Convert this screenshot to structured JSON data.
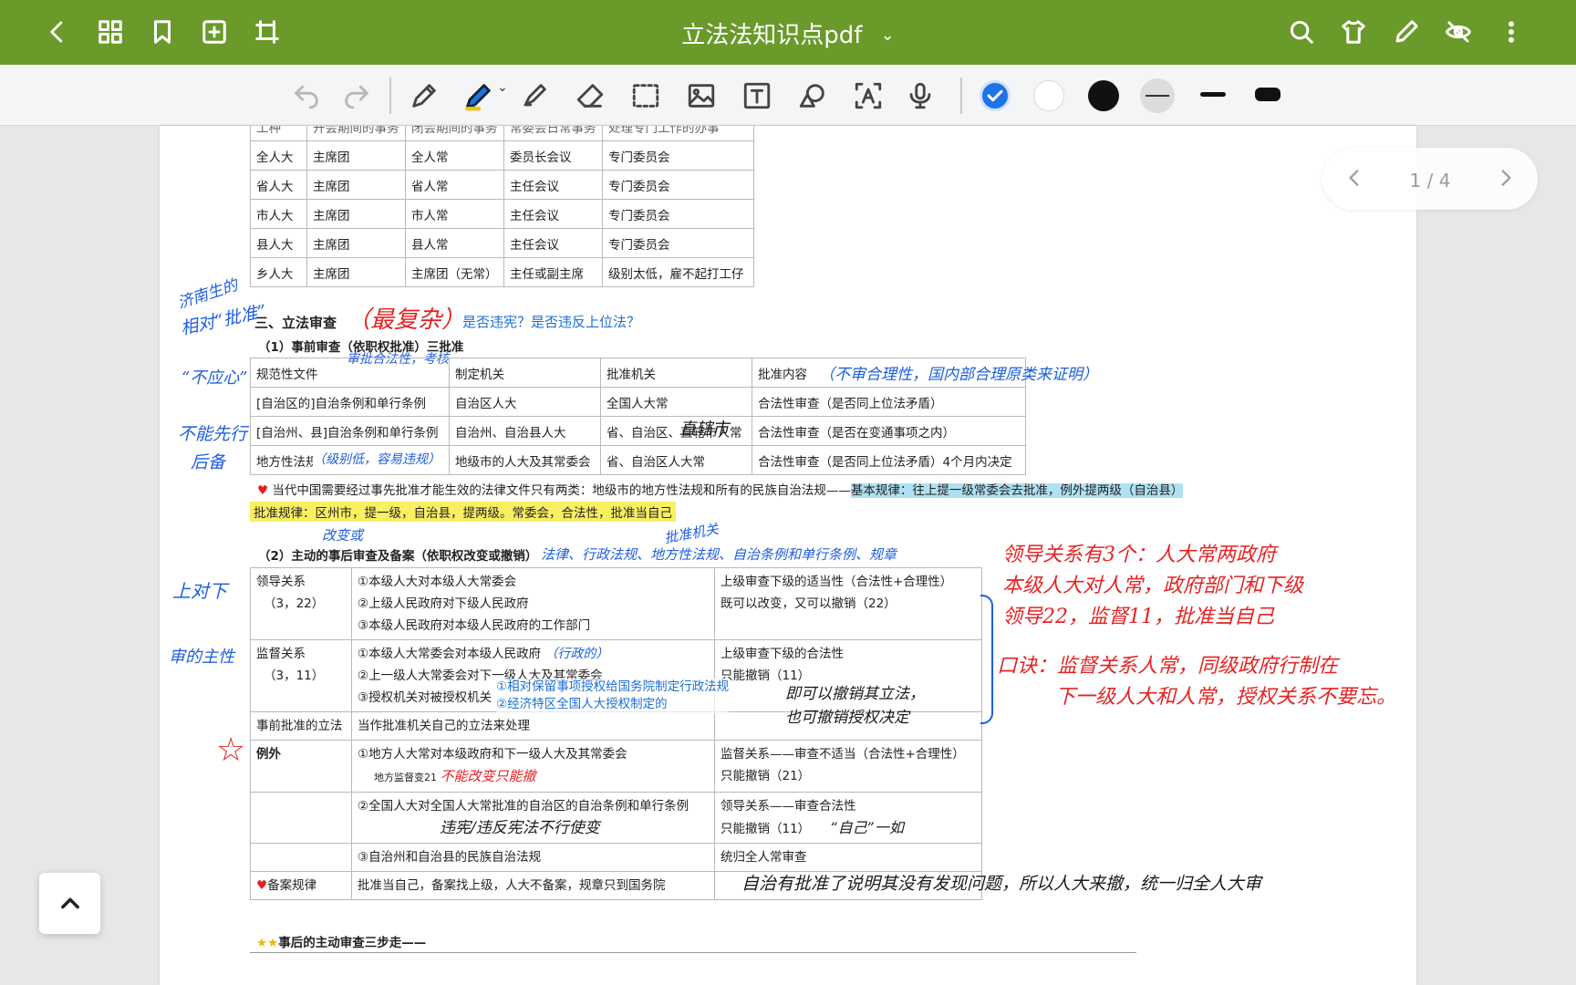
{
  "app": {
    "title": "立法法知识点pdf",
    "bar_color": "#6a9a2a"
  },
  "toolbar": {
    "icons": [
      "undo-icon",
      "redo-icon",
      "fountain-pen-icon",
      "highlighter-pen-icon",
      "marker-icon",
      "eraser-icon",
      "lasso-select-icon",
      "image-icon",
      "text-box-icon",
      "shape-icon",
      "text-recognition-icon",
      "microphone-icon"
    ],
    "colors": {
      "selected": "#1f73e8",
      "white": "#ffffff",
      "black": "#111111",
      "gray": "#dcdcdc"
    }
  },
  "pager": {
    "label": "1 / 4"
  },
  "table1": {
    "header": [
      "工种",
      "开会期间的事务",
      "闭会期间的事务",
      "常委会日常事务",
      "处理专门工作的办事"
    ],
    "rows": [
      [
        "全人大",
        "主席团",
        "全人常",
        "委员长会议",
        "专门委员会"
      ],
      [
        "省人大",
        "主席团",
        "省人常",
        "主任会议",
        "专门委员会"
      ],
      [
        "市人大",
        "主席团",
        "市人常",
        "主任会议",
        "专门委员会"
      ],
      [
        "县人大",
        "主席团",
        "县人常",
        "主任会议",
        "专门委员会"
      ],
      [
        "乡人大",
        "主席团",
        "主席团（无常）",
        "主任或副主席",
        "级别太低，雇不起打工仔"
      ]
    ]
  },
  "section3": {
    "title": "三、立法审查",
    "question": "是否违宪？是否违反上位法？",
    "sub1": "（1）事前审查（依职权批准）三批准"
  },
  "table2": {
    "header": [
      "规范性文件",
      "制定机关",
      "批准机关",
      "批准内容"
    ],
    "rows": [
      [
        "[自治区的]自治条例和单行条例",
        "自治区人大",
        "全国人大常",
        "合法性审查（是否同上位法矛盾）"
      ],
      [
        "[自治州、县]自治条例和单行条例",
        "自治州、自治县人大",
        "省、自治区、直辖市人常",
        "合法性审查（是否在变通事项之内）"
      ],
      [
        "地方性法规",
        "地级市的人大及其常委会",
        "省、自治区人大常",
        "合法性审查（是否同上位法矛盾）4个月内决定"
      ]
    ]
  },
  "notes": {
    "heart1_a": "当代中国需要经过事先批准才能生效的法律文件只有两类：地级市的地方性法规和所有的民族自治法规——",
    "heart1_b": "基本规律：往上提一级常委会去批准，例外提两级（自治县）",
    "rule": "批准规律：区州市，提一级，自治县，提两级。常委会，合法性，批准当自己",
    "sub2": "（2）主动的事后审查及备案（依职权改变或撤销）",
    "bottom": "事后的主动审查三步走——"
  },
  "table3": {
    "rows": [
      {
        "c1": "领导关系",
        "c1b": "（3，22）",
        "c2": [
          "①本级人大对本级人大常委会",
          "②上级人民政府对下级人民政府",
          "③本级人民政府对本级人民政府的工作部门"
        ],
        "c3": [
          "上级审查下级的适当性（合法性+合理性）",
          "既可以改变，又可以撤销（22）"
        ]
      },
      {
        "c1": "监督关系",
        "c1b": "（3，11）",
        "c2": [
          "①本级人大常委会对本级人民政府",
          "②上一级人大常委会对下一级人大及其常委会",
          "③授权机关对被授权机关"
        ],
        "c3": [
          "上级审查下级的合法性",
          "只能撤销（11）"
        ],
        "overlay": [
          "①相对保留事项授权给国务院制定行政法规",
          "②经济特区全国人大授权制定的"
        ]
      },
      {
        "c1": "事前批准的立法",
        "c2": [
          "当作批准机关自己的立法来处理"
        ],
        "c3": []
      },
      {
        "c1": "例外",
        "c2": [
          "①地方人大常对本级政府和下一级人大及其常委会",
          "地方监督变21"
        ],
        "c3": [
          "监督关系——审查不适当（合法性+合理性）",
          "只能撤销（21）"
        ]
      },
      {
        "c1": "",
        "c2": [
          "②全国人大对全国人大常批准的自治区的自治条例和单行条例"
        ],
        "c3": [
          "领导关系——审查合法性",
          "只能撤销（11）"
        ]
      },
      {
        "c1": "",
        "c2": [
          "③自治州和自治县的民族自治法规"
        ],
        "c3": [
          "统归全人常审查"
        ]
      },
      {
        "c1": "备案规律",
        "c2": [
          "批准当自己，备案找上级，人大不备案，规章只到国务院"
        ],
        "c3": []
      }
    ]
  },
  "handwriting": {
    "red_top": "（最复杂）",
    "blue_left_1": "济南生的",
    "blue_left_2": "相对“批准”",
    "blue_left_3": "“不应心”",
    "blue_left_4": "不能先行",
    "blue_left_5": "后备",
    "blue_t2a": "审批合法性，考核",
    "blue_t2b": "（不审合理性，国内部合理原类来证明）",
    "blue_t2c": "（级别低，容易违规）",
    "black_t2": "直辖市",
    "blue_mid1": "改变或",
    "blue_mid2": "批准机关",
    "blue_mid3": "法律、行政法规、地方性法规、自治条例和单行条例、规章",
    "blue_lead": "上对下",
    "blue_sup": "审的主性",
    "blue_inline": "（行政的）",
    "red_right1": "领导关系有3个：人大常两政府",
    "red_right2": "本级人大对人常，政府部门和下级",
    "red_right3": "领导22，监督11，批准当自己",
    "red_right4": "口诀：监督关系人常，同级政府行制在",
    "red_right5": "下一级人大和人常，授权关系不要忘。",
    "black_a": "即可以撤销其立法，",
    "black_b": "也可撤销授权决定",
    "red_ex": "不能改变只能撤",
    "black_ex2": "违宪/违反宪法不行使变",
    "black_ex3": "“自己”一如",
    "black_bottom": "自治有批准了说明其没有发现问题，所以人大来撤，统一归全人大审",
    "red_star": "☆"
  }
}
